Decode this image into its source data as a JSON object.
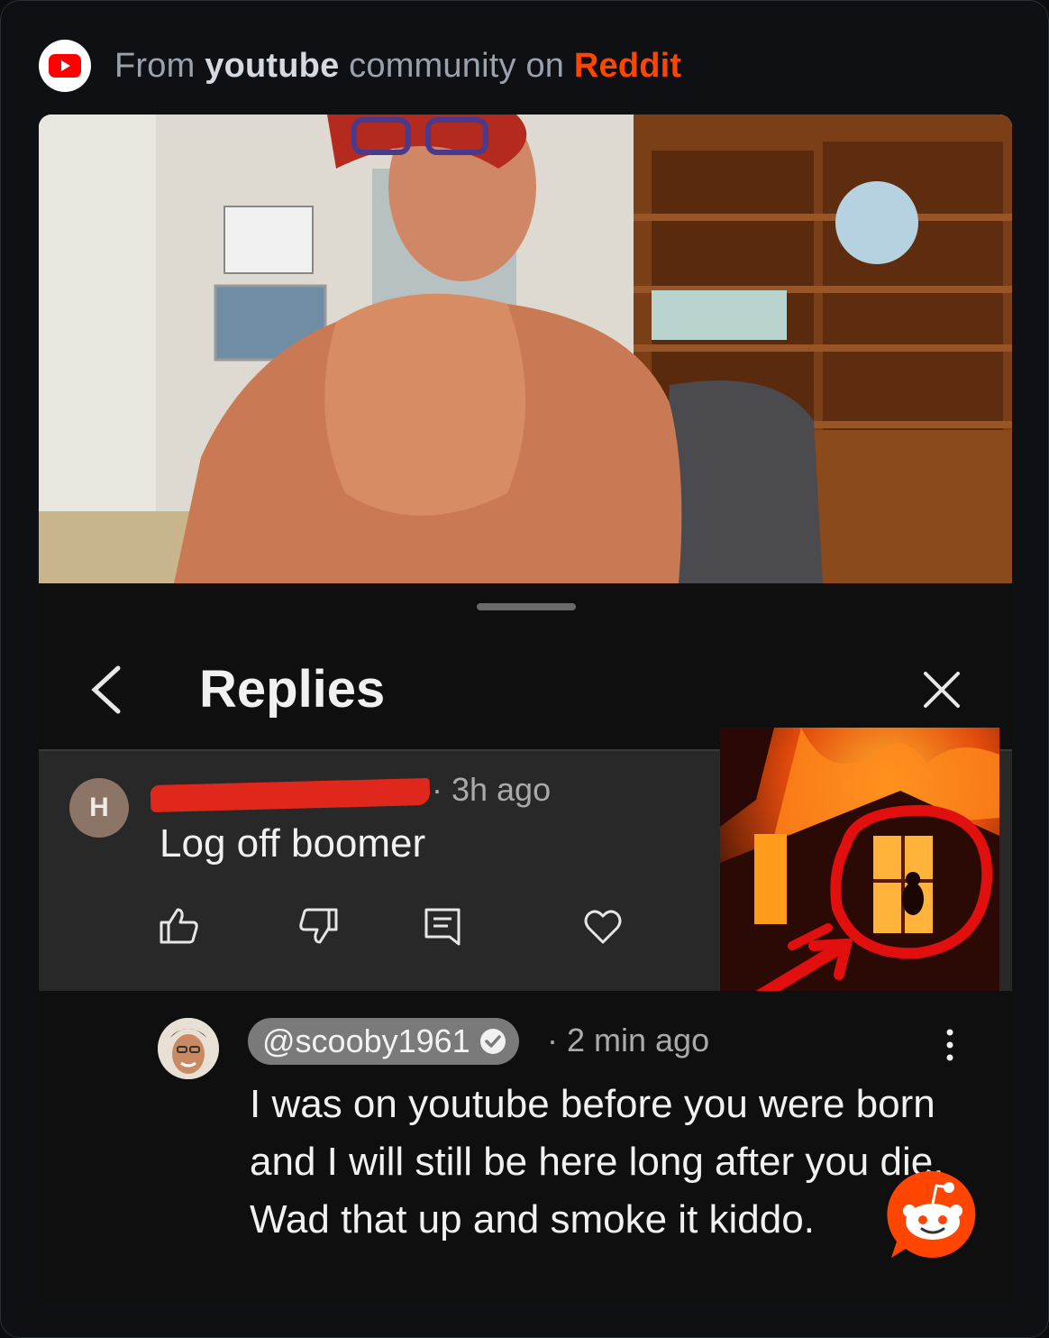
{
  "header": {
    "prefix": "From",
    "community": "youtube",
    "middle": "community on",
    "platform": "Reddit",
    "icon": "youtube-logo-icon"
  },
  "colors": {
    "reddit_orange": "#ff4500",
    "youtube_red": "#ff0000",
    "redaction_red": "#e0271c"
  },
  "replies_panel": {
    "title": "Replies",
    "back_icon": "chevron-left-icon",
    "close_icon": "close-icon"
  },
  "comment_1": {
    "avatar_letter": "H",
    "time": "· 3h ago",
    "text": "Log off boomer",
    "actions": [
      "thumbs-up-icon",
      "thumbs-down-icon",
      "reply-icon",
      "heart-icon"
    ]
  },
  "comment_2": {
    "handle": "@scooby1961",
    "time": "· 2 min ago",
    "text": "I was on youtube before you were born and I will still be here long after you die.  Wad that up and smoke it kiddo.",
    "verified_icon": "check-circle-icon",
    "menu_icon": "more-vertical-icon"
  },
  "watermark_icon": "reddit-snoo-icon"
}
